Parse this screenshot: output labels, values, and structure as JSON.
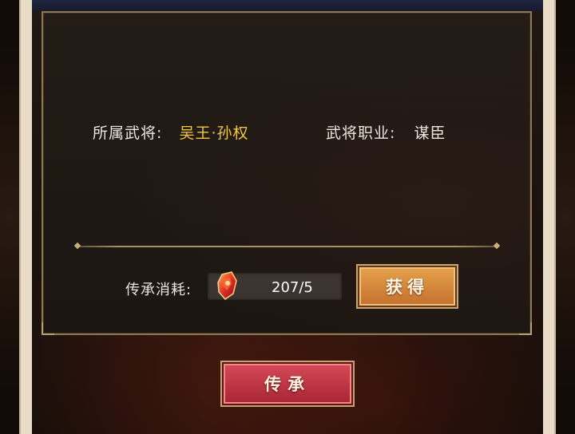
{
  "general": {
    "label": "所属武将:",
    "value": "吴王·孙权"
  },
  "profession": {
    "label": "武将职业:",
    "value": "谋臣"
  },
  "cost": {
    "label": "传承消耗:",
    "value": "207/5",
    "icon": "red-gem-icon"
  },
  "buttons": {
    "get_label": "获得",
    "inherit_label": "传承"
  },
  "colors": {
    "gold_text": "#f3c93a",
    "get_button": "#d98a3a",
    "inherit_button": "#c2323f"
  }
}
